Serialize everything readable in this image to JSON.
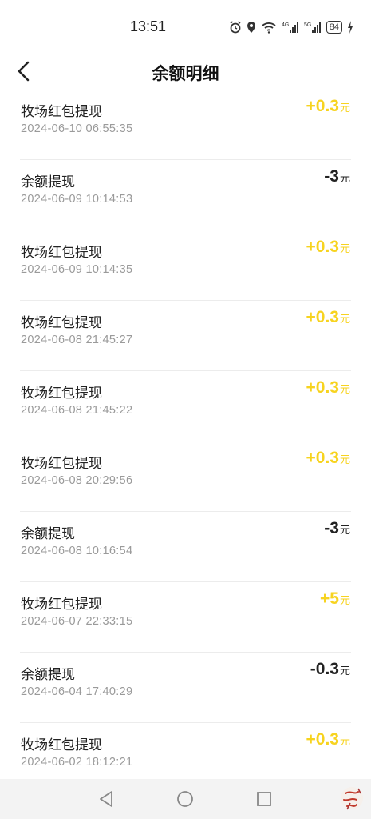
{
  "status_bar": {
    "time": "13:51",
    "battery": "84"
  },
  "header": {
    "title": "余额明细"
  },
  "records": [
    {
      "name": "牧场红包提现",
      "time": "2024-06-10 06:55:35",
      "amount": "+0.3",
      "unit": "元",
      "type": "pos"
    },
    {
      "name": "余额提现",
      "time": "2024-06-09 10:14:53",
      "amount": "-3",
      "unit": "元",
      "type": "neg"
    },
    {
      "name": "牧场红包提现",
      "time": "2024-06-09 10:14:35",
      "amount": "+0.3",
      "unit": "元",
      "type": "pos"
    },
    {
      "name": "牧场红包提现",
      "time": "2024-06-08 21:45:27",
      "amount": "+0.3",
      "unit": "元",
      "type": "pos"
    },
    {
      "name": "牧场红包提现",
      "time": "2024-06-08 21:45:22",
      "amount": "+0.3",
      "unit": "元",
      "type": "pos"
    },
    {
      "name": "牧场红包提现",
      "time": "2024-06-08 20:29:56",
      "amount": "+0.3",
      "unit": "元",
      "type": "pos"
    },
    {
      "name": "余额提现",
      "time": "2024-06-08 10:16:54",
      "amount": "-3",
      "unit": "元",
      "type": "neg"
    },
    {
      "name": "牧场红包提现",
      "time": "2024-06-07 22:33:15",
      "amount": "+5",
      "unit": "元",
      "type": "pos"
    },
    {
      "name": "余额提现",
      "time": "2024-06-04 17:40:29",
      "amount": "-0.3",
      "unit": "元",
      "type": "neg"
    },
    {
      "name": "牧场红包提现",
      "time": "2024-06-02 18:12:21",
      "amount": "+0.3",
      "unit": "元",
      "type": "pos"
    }
  ],
  "colors": {
    "positive": "#f7d31f",
    "negative": "#222222",
    "nav_bg": "#f3f3f3"
  },
  "icons": [
    "alarm-icon",
    "location-icon",
    "wifi-icon",
    "signal-4g-icon",
    "signal-5g-icon",
    "battery-icon",
    "charging-icon",
    "back-icon",
    "nav-back-icon",
    "nav-home-icon",
    "nav-recents-icon"
  ]
}
